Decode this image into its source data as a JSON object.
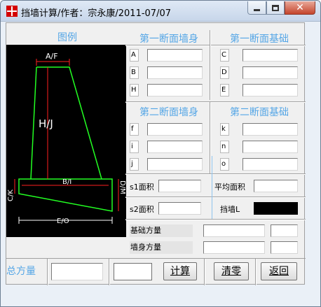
{
  "window": {
    "title": "挡墙计算/作者：宗永康/2011-07/07"
  },
  "legend": {
    "title": "图例",
    "labels": {
      "top": "A/F",
      "height": "H/J",
      "base_top": "B/I",
      "left_side": "C/K",
      "right_side": "D/M",
      "bottom": "E/O"
    }
  },
  "section1": {
    "wall_header": "第一断面墙身",
    "foundation_header": "第一断面基础",
    "wall_fields": [
      {
        "label": "A",
        "value": ""
      },
      {
        "label": "B",
        "value": ""
      },
      {
        "label": "H",
        "value": ""
      }
    ],
    "foundation_fields": [
      {
        "label": "C",
        "value": ""
      },
      {
        "label": "D",
        "value": ""
      },
      {
        "label": "E",
        "value": ""
      }
    ]
  },
  "section2": {
    "wall_header": "第二断面墙身",
    "foundation_header": "第二断面基础",
    "wall_fields": [
      {
        "label": "f",
        "value": ""
      },
      {
        "label": "i",
        "value": ""
      },
      {
        "label": "j",
        "value": ""
      }
    ],
    "foundation_fields": [
      {
        "label": "k",
        "value": ""
      },
      {
        "label": "n",
        "value": ""
      },
      {
        "label": "o",
        "value": ""
      }
    ]
  },
  "areas": {
    "s1_label": "s1面积",
    "s1_value": "",
    "s2_label": "s2面积",
    "s2_value": "",
    "avg_label": "平均面积",
    "avg_value": "",
    "length_label": "挡墙L",
    "length_color": "#000000"
  },
  "volumes": {
    "foundation_label": "基础方量",
    "foundation_value": "",
    "foundation_extra": "",
    "wall_label": "墙身方量",
    "wall_value": "",
    "wall_extra": ""
  },
  "footer": {
    "total_label": "总方量",
    "total_value": "",
    "total_extra": "",
    "calc_button": "计算",
    "clear_button": "清零",
    "back_button": "返回"
  },
  "colors": {
    "header_blue": "#55a6e6",
    "diagram_line_green": "#22ff22",
    "diagram_line_red": "#ff2020"
  }
}
